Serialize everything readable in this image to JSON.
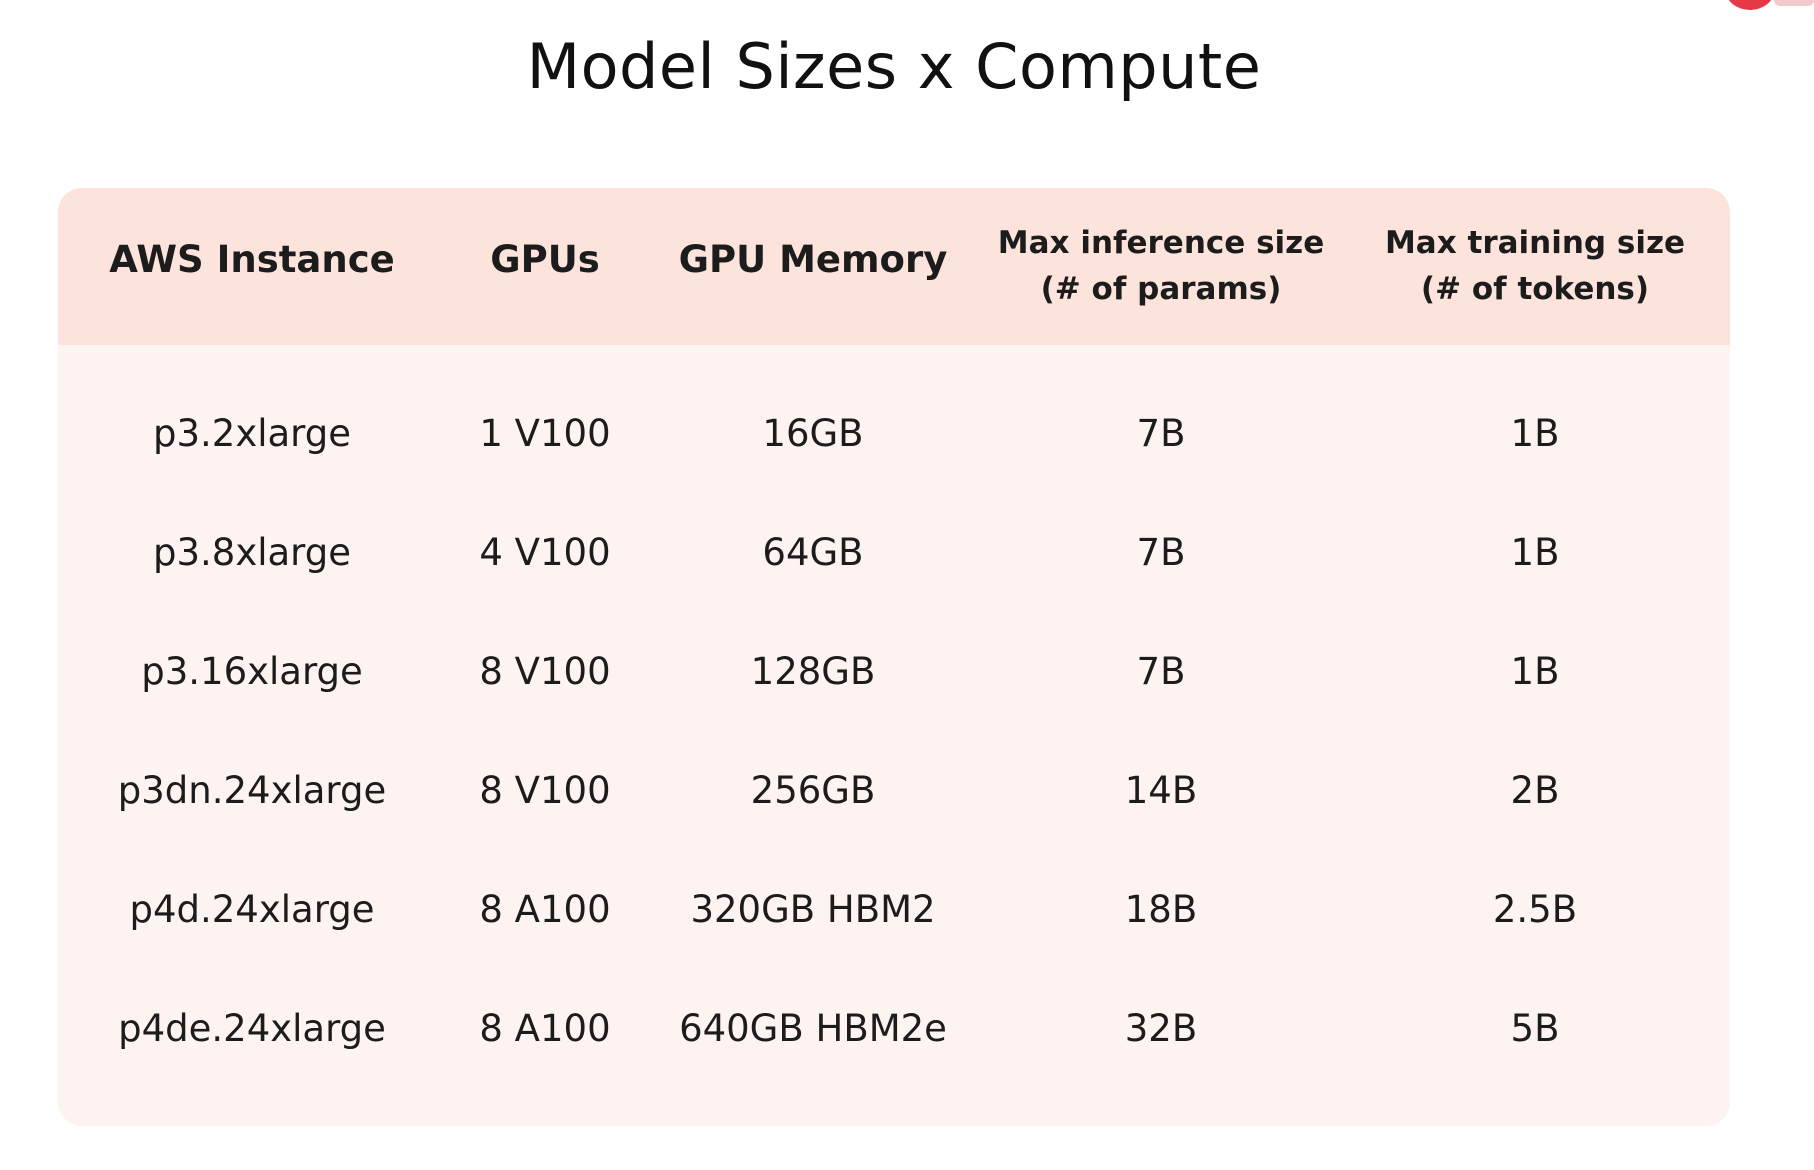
{
  "slide": {
    "title": "Model Sizes x Compute"
  },
  "table": {
    "headers": [
      {
        "line1": "AWS Instance"
      },
      {
        "line1": "GPUs"
      },
      {
        "line1": "GPU Memory"
      },
      {
        "line1": "Max inference size",
        "line2": "(# of params)"
      },
      {
        "line1": "Max training size",
        "line2": "(# of tokens)"
      }
    ],
    "rows": [
      [
        "p3.2xlarge",
        "1 V100",
        "16GB",
        "7B",
        "1B"
      ],
      [
        "p3.8xlarge",
        "4 V100",
        "64GB",
        "7B",
        "1B"
      ],
      [
        "p3.16xlarge",
        "8 V100",
        "128GB",
        "7B",
        "1B"
      ],
      [
        "p3dn.24xlarge",
        "8 V100",
        "256GB",
        "14B",
        "2B"
      ],
      [
        "p4d.24xlarge",
        "8 A100",
        "320GB HBM2",
        "18B",
        "2.5B"
      ],
      [
        "p4de.24xlarge",
        "8 A100",
        "640GB HBM2e",
        "32B",
        "5B"
      ]
    ]
  },
  "colors": {
    "header_background": "#fce4dc",
    "body_background": "#fdf3f1",
    "accent": "#e63946"
  }
}
